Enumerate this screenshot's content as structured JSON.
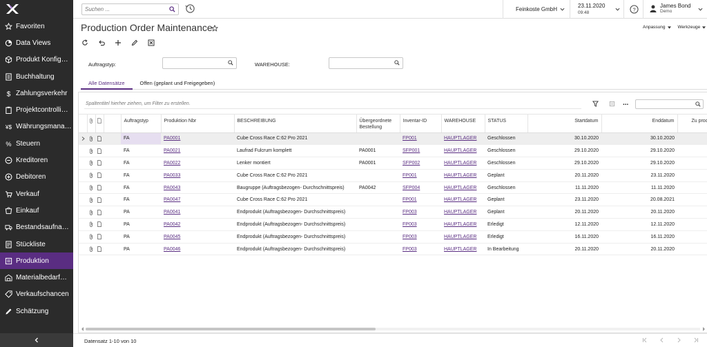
{
  "sidebar": {
    "items": [
      {
        "label": "Favoriten",
        "icon": "star-icon"
      },
      {
        "label": "Data Views",
        "icon": "chart-icon"
      },
      {
        "label": "Produkt Konfig…",
        "icon": "cube-icon"
      },
      {
        "label": "Buchhaltung",
        "icon": "ledger-icon"
      },
      {
        "label": "Zahlungsverkehr",
        "icon": "dollar-icon"
      },
      {
        "label": "Projektcontrolli…",
        "icon": "clipboard-icon"
      },
      {
        "label": "Währungsmana…",
        "icon": "currency-icon"
      },
      {
        "label": "Steuern",
        "icon": "percent-icon"
      },
      {
        "label": "Kreditoren",
        "icon": "minus-circle-icon"
      },
      {
        "label": "Debitoren",
        "icon": "plus-circle-icon"
      },
      {
        "label": "Verkauf",
        "icon": "cart-icon"
      },
      {
        "label": "Einkauf",
        "icon": "purchase-icon"
      },
      {
        "label": "Bestandsaufna…",
        "icon": "truck-icon"
      },
      {
        "label": "Stückliste",
        "icon": "list-icon"
      },
      {
        "label": "Produktion",
        "icon": "production-icon"
      },
      {
        "label": "Materialbedarf…",
        "icon": "material-icon"
      },
      {
        "label": "Verkaufschancen",
        "icon": "tag-icon"
      },
      {
        "label": "Schätzung",
        "icon": "pencil-icon"
      }
    ],
    "active_index": 14
  },
  "topbar": {
    "search_placeholder": "Suchen ...",
    "company": "Feinkoste GmbH",
    "date": "23.11.2020",
    "time": "09:48",
    "user_name": "James Bond",
    "user_company": "Demo"
  },
  "page": {
    "title": "Production Order Maintenance",
    "customize_label": "Anpassung",
    "tools_label": "Werkzeuge"
  },
  "filters": {
    "order_type_label": "Auftragstyp:",
    "warehouse_label": "WAREHOUSE:"
  },
  "tabs": [
    "Alle Datensätze",
    "Offen (geplant und Freigegeben)"
  ],
  "grid": {
    "group_placeholder": "Spaltentitel hierher ziehen, um Filter zu erstellen.",
    "columns": [
      "Auftragstyp",
      "Produktion Nbr",
      "BESCHREIBUNG",
      "Übergeordnete Bestellung",
      "Inventar-ID",
      "WAREHOUSE",
      "STATUS",
      "Startdatum",
      "Enddatum",
      "Zu produ"
    ],
    "rows": [
      {
        "type": "FA",
        "nbr": "PA0001",
        "desc": "Cube Cross Race C:62 Pro 2021",
        "parent": "",
        "inv": "FP001",
        "wh": "HAUPTLAGER",
        "status": "Geschlossen",
        "start": "30.10.2020",
        "end": "30.10.2020"
      },
      {
        "type": "FA",
        "nbr": "PA0021",
        "desc": "Laufrad Fulcrum komplett",
        "parent": "PA0001",
        "inv": "SFP001",
        "wh": "HAUPTLAGER",
        "status": "Geschlossen",
        "start": "29.10.2020",
        "end": "29.10.2020"
      },
      {
        "type": "FA",
        "nbr": "PA0022",
        "desc": "Lenker montiert",
        "parent": "PA0001",
        "inv": "SFP002",
        "wh": "HAUPTLAGER",
        "status": "Geschlossen",
        "start": "29.10.2020",
        "end": "29.10.2020"
      },
      {
        "type": "FA",
        "nbr": "PA0033",
        "desc": "Cube Cross Race C:62 Pro 2021",
        "parent": "",
        "inv": "FP001",
        "wh": "HAUPTLAGER",
        "status": "Geplant",
        "start": "20.11.2020",
        "end": "23.11.2020"
      },
      {
        "type": "FA",
        "nbr": "PA0043",
        "desc": "Baugruppe (Auftragsbezogen- Durchschnittspreis)",
        "parent": "PA0042",
        "inv": "SFP004",
        "wh": "HAUPTLAGER",
        "status": "Geschlossen",
        "start": "11.11.2020",
        "end": "11.11.2020"
      },
      {
        "type": "FA",
        "nbr": "PA0047",
        "desc": "Cube Cross Race C:62 Pro 2021",
        "parent": "",
        "inv": "FP001",
        "wh": "HAUPTLAGER",
        "status": "Geplant",
        "start": "23.11.2020",
        "end": "20.08.2021"
      },
      {
        "type": "PA",
        "nbr": "PA0041",
        "desc": "Endprodukt (Auftragsbezogen- Durchschnittspreis)",
        "parent": "",
        "inv": "FP003",
        "wh": "HAUPTLAGER",
        "status": "Geplant",
        "start": "20.11.2020",
        "end": "20.11.2020"
      },
      {
        "type": "PA",
        "nbr": "PA0042",
        "desc": "Endprodukt (Auftragsbezogen- Durchschnittspreis)",
        "parent": "",
        "inv": "FP003",
        "wh": "HAUPTLAGER",
        "status": "Erledigt",
        "start": "12.11.2020",
        "end": "12.11.2020"
      },
      {
        "type": "PA",
        "nbr": "PA0045",
        "desc": "Endprodukt (Auftragsbezogen- Durchschnittspreis)",
        "parent": "",
        "inv": "FP003",
        "wh": "HAUPTLAGER",
        "status": "Erledigt",
        "start": "16.11.2020",
        "end": "16.11.2020"
      },
      {
        "type": "PA",
        "nbr": "PA0046",
        "desc": "Endprodukt (Auftragsbezogen- Durchschnittspreis)",
        "parent": "",
        "inv": "FP003",
        "wh": "HAUPTLAGER",
        "status": "In Bearbeitung",
        "start": "20.11.2020",
        "end": "20.11.2020"
      }
    ]
  },
  "footer": {
    "record_count": "Datensatz 1-10 von 10"
  },
  "colors": {
    "sidebar_bg": "#2b2b2b",
    "accent": "#5a2d82",
    "selected_row": "#eeeeee"
  }
}
